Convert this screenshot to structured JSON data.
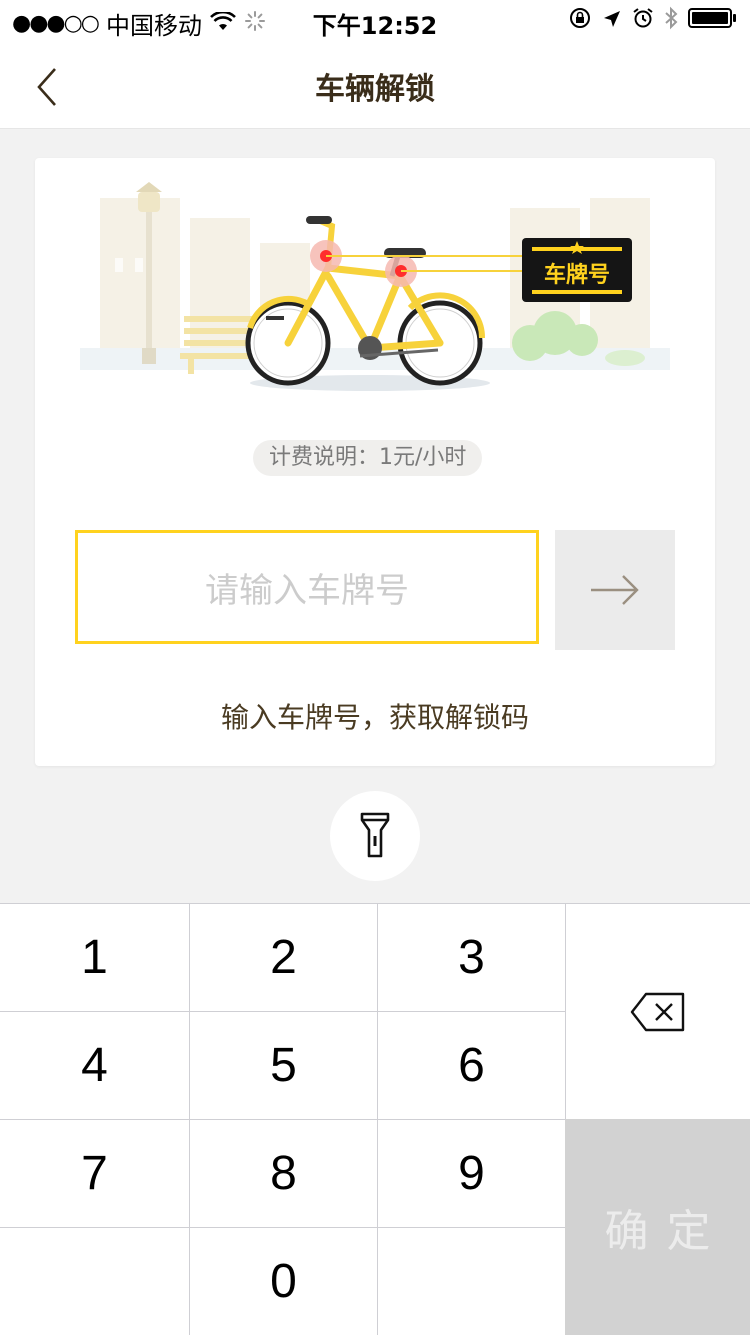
{
  "status_bar": {
    "signal": "●●●○○",
    "carrier": "中国移动",
    "time": "下午12:52"
  },
  "nav": {
    "title": "车辆解锁"
  },
  "card": {
    "plate_sign": "车牌号",
    "fee_note": "计费说明：1元/小时",
    "input_placeholder": "请输入车牌号",
    "hint": "输入车牌号，获取解锁码"
  },
  "keypad": {
    "keys": [
      "1",
      "2",
      "3",
      "4",
      "5",
      "6",
      "7",
      "8",
      "9",
      "0"
    ],
    "confirm_label": "确定"
  },
  "colors": {
    "accent_yellow": "#ffd21e",
    "title_brown": "#3a2d1a",
    "confirm_bg": "#d2d2d2"
  },
  "icons": [
    "back-chevron-icon",
    "wifi-icon",
    "loading-icon",
    "lock-rotation-icon",
    "location-arrow-icon",
    "alarm-icon",
    "bluetooth-icon",
    "battery-icon",
    "arrow-right-icon",
    "flashlight-icon",
    "backspace-icon"
  ]
}
